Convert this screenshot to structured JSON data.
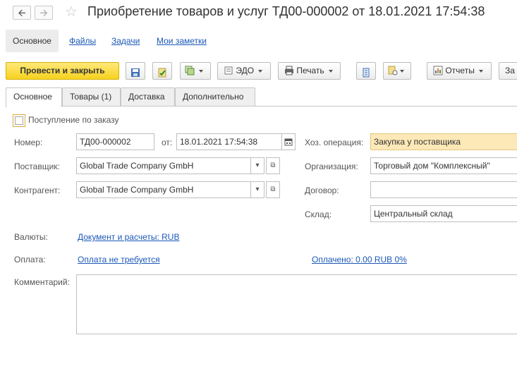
{
  "window": {
    "title": "Приобретение товаров и услуг ТД00-000002 от 18.01.2021 17:54:38"
  },
  "sections": [
    {
      "label": "Основное"
    },
    {
      "label": "Файлы"
    },
    {
      "label": "Задачи"
    },
    {
      "label": "Мои заметки"
    }
  ],
  "toolbar": {
    "post_close": "Провести и закрыть",
    "edo": "ЭДО",
    "print": "Печать",
    "reports": "Отчеты",
    "cut_button": "За"
  },
  "tabs": [
    {
      "label": "Основное"
    },
    {
      "label": "Товары (1)"
    },
    {
      "label": "Доставка"
    },
    {
      "label": "Дополнительно"
    }
  ],
  "form": {
    "by_order_label": "Поступление по заказу",
    "number_label": "Номер:",
    "number_value": "ТД00-000002",
    "date_label": "от:",
    "date_value": "18.01.2021 17:54:38",
    "operation_label": "Хоз. операция:",
    "operation_value": "Закупка у поставщика",
    "supplier_label": "Поставщик:",
    "supplier_value": "Global Trade Company GmbH",
    "organization_label": "Организация:",
    "organization_value": "Торговый дом \"Комплексный\"",
    "counterparty_label": "Контрагент:",
    "counterparty_value": "Global Trade Company GmbH",
    "contract_label": "Договор:",
    "contract_value": "",
    "warehouse_label": "Склад:",
    "warehouse_value": "Центральный склад",
    "currency_label": "Валюты:",
    "currency_link": "Документ и расчеты: RUB",
    "payment_label": "Оплата:",
    "payment_link": "Оплата не требуется",
    "paid_link": "Оплачено: 0.00 RUB 0%",
    "comment_label": "Комментарий:",
    "comment_value": ""
  }
}
